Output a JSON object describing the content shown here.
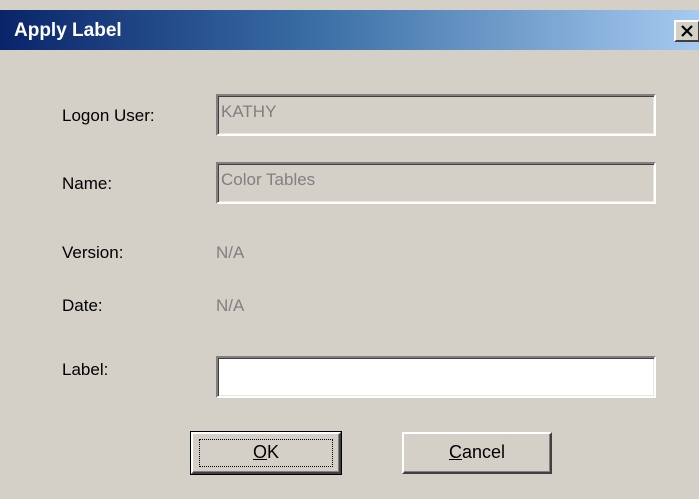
{
  "window": {
    "title": "Apply Label",
    "close_glyph": "✕"
  },
  "fields": {
    "logon_user": {
      "label": "Logon User:",
      "value": "KATHY"
    },
    "name": {
      "label": "Name:",
      "value": "Color Tables"
    },
    "version": {
      "label": "Version:",
      "value": "N/A"
    },
    "date": {
      "label": "Date:",
      "value": "N/A"
    },
    "label": {
      "label": "Label:",
      "value": ""
    }
  },
  "buttons": {
    "ok": {
      "mnemonic": "O",
      "rest": "K"
    },
    "cancel": {
      "mnemonic": "C",
      "rest": "ancel"
    }
  },
  "colors": {
    "titlebar_start": "#0a246a",
    "titlebar_end": "#a6caf0",
    "face": "#d4d0c8",
    "disabled_text": "#808080"
  }
}
